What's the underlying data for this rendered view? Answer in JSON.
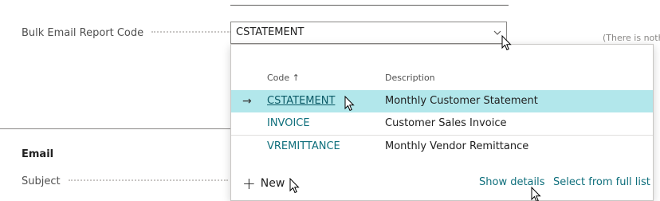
{
  "fields": {
    "bulk_email_label": "Bulk Email Report Code",
    "bulk_email_value": "CSTATEMENT",
    "side_note": "(There is noth",
    "section_email": "Email",
    "subject_label": "Subject"
  },
  "lookup": {
    "columns": {
      "code": "Code",
      "code_sort": "↑",
      "description": "Description"
    },
    "rows": [
      {
        "arrow": "→",
        "code": "CSTATEMENT",
        "description": "Monthly Customer Statement",
        "selected": true
      },
      {
        "arrow": "",
        "code": "INVOICE",
        "description": "Customer Sales Invoice",
        "selected": false
      },
      {
        "arrow": "",
        "code": "VREMITTANCE",
        "description": "Monthly Vendor Remittance",
        "selected": false
      }
    ],
    "new_label": "New",
    "new_icon": "+",
    "show_details": "Show details",
    "select_full_list": "Select from full list"
  },
  "icons": [
    "chevron-down-icon",
    "plus-icon",
    "mouse-pointer-icon",
    "row-arrow-icon"
  ],
  "colors": {
    "selected_row": "#b2e7eb",
    "link": "#0f6f7c"
  }
}
